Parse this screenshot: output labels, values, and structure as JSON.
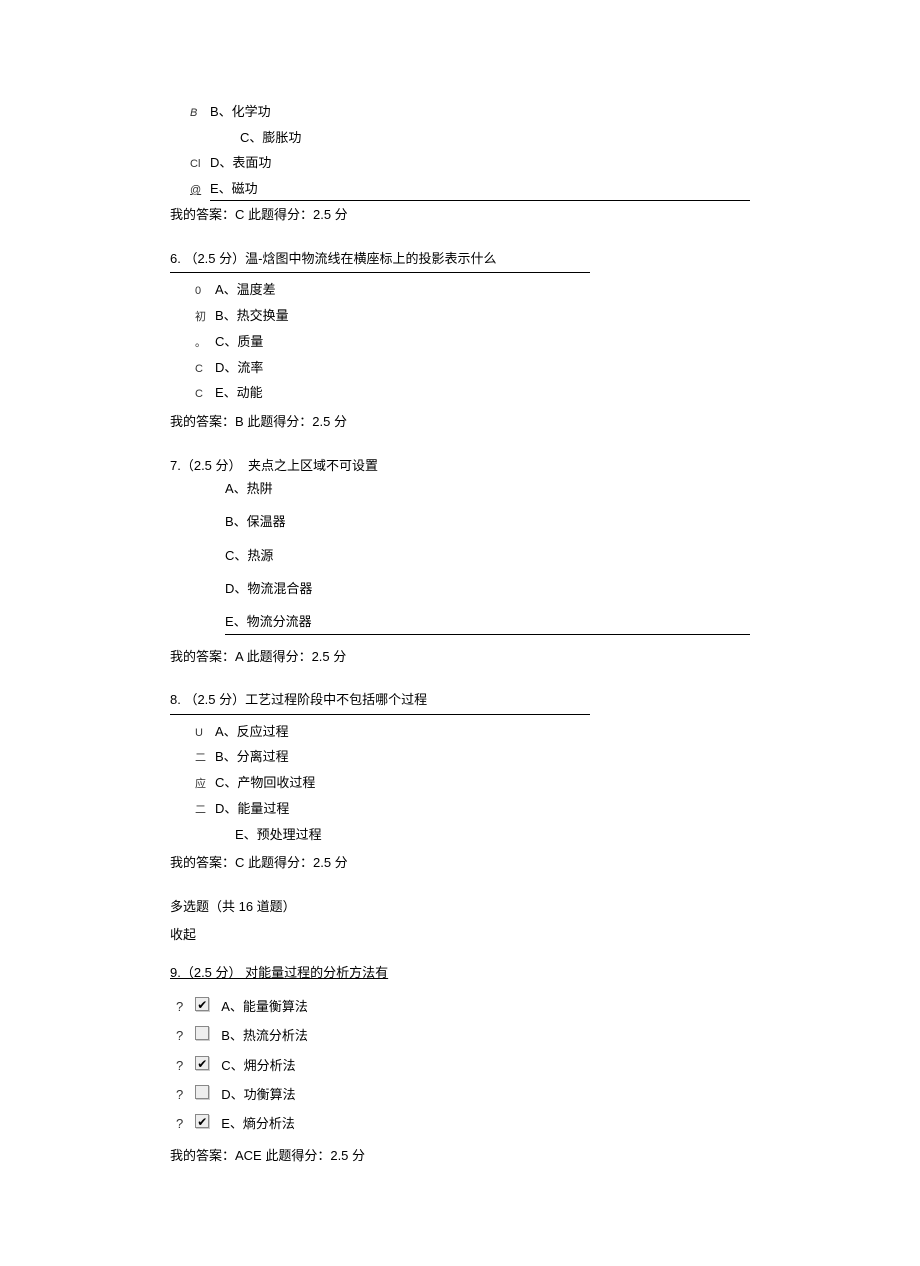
{
  "partial_question": {
    "options": [
      {
        "prefix": "B",
        "prefix_style": "italic",
        "label": "B、化学功"
      },
      {
        "prefix": "",
        "label": "C、膨胀功"
      },
      {
        "prefix": "Cl",
        "label": "D、表面功"
      },
      {
        "prefix": "@",
        "prefix_style": "underline",
        "label": "E、磁功",
        "underline": true
      }
    ],
    "answer": "我的答案：C 此题得分：2.5 分"
  },
  "q6": {
    "header": "6. （2.5 分）温-焓图中物流线在横座标上的投影表示什么",
    "options": [
      {
        "prefix": "0",
        "label": "A、温度差"
      },
      {
        "prefix": "初",
        "label": "B、热交换量"
      },
      {
        "prefix": "。",
        "label": "C、质量"
      },
      {
        "prefix": "C",
        "label": "D、流率"
      },
      {
        "prefix": "C",
        "label": "E、动能"
      }
    ],
    "answer": "我的答案：B 此题得分：2.5 分"
  },
  "q7": {
    "header": "7.（2.5 分）　夹点之上区域不可设置",
    "options": [
      {
        "label": "A、热阱"
      },
      {
        "label": "B、保温器"
      },
      {
        "label": "C、热源"
      },
      {
        "label": "D、物流混合器"
      },
      {
        "label": "E、物流分流器",
        "underline": true
      }
    ],
    "answer": "我的答案：A 此题得分：2.5 分"
  },
  "q8": {
    "header": "8. （2.5 分）工艺过程阶段中不包括哪个过程",
    "options": [
      {
        "prefix": "U",
        "label": "A、反应过程"
      },
      {
        "prefix": "二",
        "label": "B、分离过程"
      },
      {
        "prefix": "应",
        "label": "C、产物回收过程"
      },
      {
        "prefix": "二",
        "label": "D、能量过程"
      },
      {
        "prefix": "",
        "label": "E、预处理过程"
      }
    ],
    "answer": "我的答案：C 此题得分：2.5 分"
  },
  "section": {
    "title": "多选题（共 16 道题）",
    "sub": "收起"
  },
  "q9": {
    "header": "9.（2.5 分） 对能量过程的分析方法有",
    "options": [
      {
        "marker": "?",
        "checked": true,
        "label": "A、能量衡算法"
      },
      {
        "marker": "?",
        "checked": false,
        "label": "B、热流分析法"
      },
      {
        "marker": "?",
        "checked": true,
        "label": "C、㶲分析法"
      },
      {
        "marker": "?",
        "checked": false,
        "label": "D、功衡算法"
      },
      {
        "marker": "?",
        "checked": true,
        "label": "E、熵分析法"
      }
    ],
    "answer": "我的答案：ACE 此题得分：2.5 分"
  }
}
